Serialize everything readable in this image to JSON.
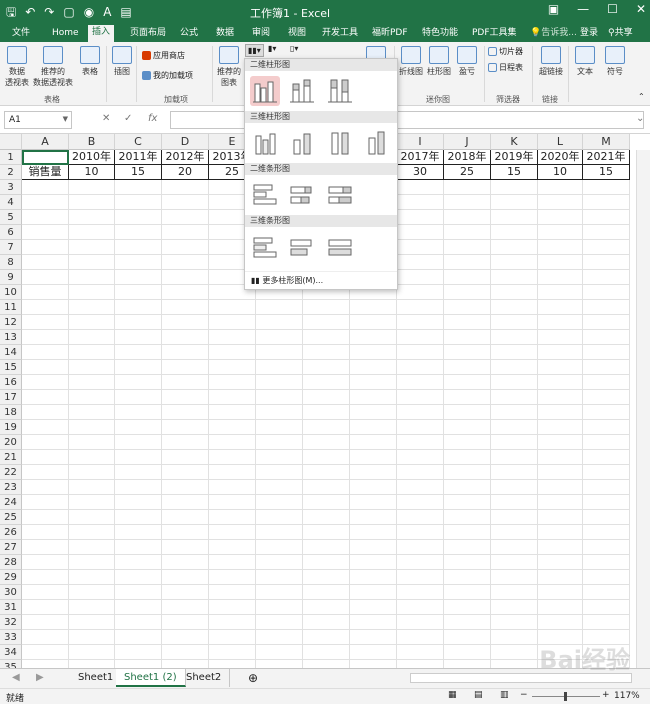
{
  "window": {
    "title": "工作簿1 - Excel",
    "accent_color": "#217346"
  },
  "tabs": [
    "文件",
    "Home",
    "插入",
    "页面布局",
    "公式",
    "数据",
    "审阅",
    "视图",
    "开发工具",
    "福昕PDF",
    "特色功能",
    "PDF工具集"
  ],
  "tell_me": "告诉我...",
  "login": "登录",
  "share": "共享",
  "ribbon": {
    "pivot_table": "数据\n透视表",
    "recommended_pivot": "推荐的\n数据透视表",
    "table": "表格",
    "illustrations": "插图",
    "app_store": "应用商店",
    "my_addins": "我的加载项",
    "recommended_charts": "推荐的\n图表",
    "sparkline_line": "折线图",
    "sparkline_column": "柱形图",
    "sparkline_winloss": "盈亏",
    "slicer": "切片器",
    "timeline": "日程表",
    "hyperlink": "超链接",
    "text": "文本",
    "symbol": "符号",
    "group_tables": "表格",
    "group_addins": "加载项",
    "group_sparklines": "迷你图",
    "group_filters": "筛选器",
    "group_links": "链接"
  },
  "formula_bar": {
    "name_box": "A1",
    "cancel": "✕",
    "enter": "✓",
    "fx": "fx",
    "value": ""
  },
  "dropdown": {
    "sec_2d_column": "二维柱形图",
    "sec_3d_column": "三维柱形图",
    "sec_2d_bar": "二维条形图",
    "sec_3d_bar": "三维条形图",
    "more": "更多柱形图(M)..."
  },
  "columns": [
    "A",
    "B",
    "C",
    "D",
    "E",
    "I",
    "J",
    "K",
    "L",
    "M"
  ],
  "row_numbers": [
    "1",
    "2",
    "3",
    "4",
    "5",
    "6",
    "7",
    "8",
    "9",
    "10",
    "11",
    "12",
    "13",
    "14",
    "15",
    "16",
    "17",
    "18",
    "19",
    "20",
    "21",
    "22",
    "23",
    "24",
    "25",
    "26",
    "27",
    "28",
    "29",
    "30",
    "31",
    "32",
    "33",
    "34",
    "35"
  ],
  "cells": {
    "B1": "2010年",
    "C1": "2011年",
    "D1": "2012年",
    "E1": "2013年",
    "I1": "2017年",
    "J1": "2018年",
    "K1": "2019年",
    "L1": "2020年",
    "M1": "2021年",
    "A2": "销售量",
    "B2": "10",
    "C2": "15",
    "D2": "20",
    "E2": "25",
    "I2": "30",
    "J2": "25",
    "K2": "15",
    "L2": "10",
    "M2": "15"
  },
  "sheets": [
    "Sheet1",
    "Sheet1 (2)",
    "Sheet2"
  ],
  "add_sheet": "⊕",
  "status": {
    "ready": "就绪",
    "zoom": "117%"
  },
  "watermark": "Bai经验"
}
